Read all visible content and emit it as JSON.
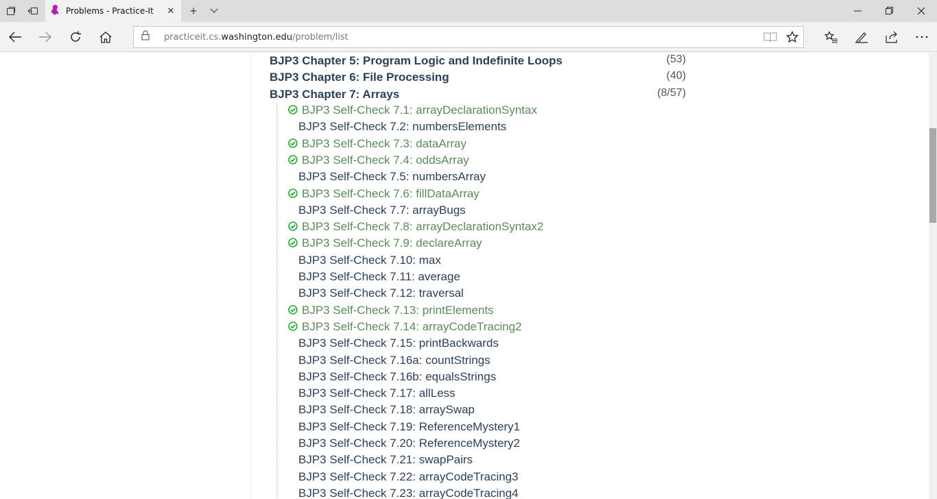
{
  "browser": {
    "tab_title": "Problems - Practice-It",
    "url_prefix": "practiceit.cs.",
    "url_domain": "washington.edu",
    "url_path": "/problem/list"
  },
  "chapters": [
    {
      "title": "BJP3 Chapter 5: Program Logic and Indefinite Loops",
      "count": "(53)"
    },
    {
      "title": "BJP3 Chapter 6: File Processing",
      "count": "(40)"
    },
    {
      "title": "BJP3 Chapter 7: Arrays",
      "count": "(8/57)"
    }
  ],
  "problems": [
    {
      "label": "BJP3 Self-Check 7.1: arrayDeclarationSyntax",
      "solved": true
    },
    {
      "label": "BJP3 Self-Check 7.2: numbersElements",
      "solved": false
    },
    {
      "label": "BJP3 Self-Check 7.3: dataArray",
      "solved": true
    },
    {
      "label": "BJP3 Self-Check 7.4: oddsArray",
      "solved": true
    },
    {
      "label": "BJP3 Self-Check 7.5: numbersArray",
      "solved": false
    },
    {
      "label": "BJP3 Self-Check 7.6: fillDataArray",
      "solved": true
    },
    {
      "label": "BJP3 Self-Check 7.7: arrayBugs",
      "solved": false
    },
    {
      "label": "BJP3 Self-Check 7.8: arrayDeclarationSyntax2",
      "solved": true
    },
    {
      "label": "BJP3 Self-Check 7.9: declareArray",
      "solved": true
    },
    {
      "label": "BJP3 Self-Check 7.10: max",
      "solved": false
    },
    {
      "label": "BJP3 Self-Check 7.11: average",
      "solved": false
    },
    {
      "label": "BJP3 Self-Check 7.12: traversal",
      "solved": false
    },
    {
      "label": "BJP3 Self-Check 7.13: printElements",
      "solved": true
    },
    {
      "label": "BJP3 Self-Check 7.14: arrayCodeTracing2",
      "solved": true
    },
    {
      "label": "BJP3 Self-Check 7.15: printBackwards",
      "solved": false
    },
    {
      "label": "BJP3 Self-Check 7.16a: countStrings",
      "solved": false
    },
    {
      "label": "BJP3 Self-Check 7.16b: equalsStrings",
      "solved": false
    },
    {
      "label": "BJP3 Self-Check 7.17: allLess",
      "solved": false
    },
    {
      "label": "BJP3 Self-Check 7.18: arraySwap",
      "solved": false
    },
    {
      "label": "BJP3 Self-Check 7.19: ReferenceMystery1",
      "solved": false
    },
    {
      "label": "BJP3 Self-Check 7.20: ReferenceMystery2",
      "solved": false
    },
    {
      "label": "BJP3 Self-Check 7.21: swapPairs",
      "solved": false
    },
    {
      "label": "BJP3 Self-Check 7.22: arrayCodeTracing3",
      "solved": false
    },
    {
      "label": "BJP3 Self-Check 7.23: arrayCodeTracing4",
      "solved": false
    }
  ],
  "colors": {
    "link": "#2d4057",
    "solved": "#5a8a5a",
    "check": "#22aa33"
  }
}
